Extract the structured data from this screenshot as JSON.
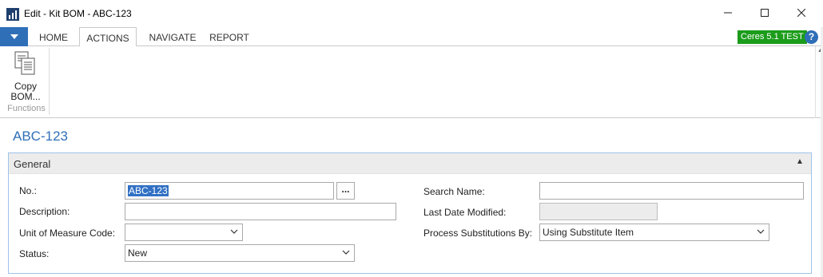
{
  "window": {
    "title": "Edit - Kit BOM - ABC-123",
    "minimize_glyph": "—",
    "maximize_glyph": "☐",
    "close_glyph": "✕"
  },
  "ribbon": {
    "tabs": [
      {
        "label": "HOME"
      },
      {
        "label": "ACTIONS"
      },
      {
        "label": "NAVIGATE"
      },
      {
        "label": "REPORT"
      }
    ],
    "active_tab": "ACTIONS",
    "environment_badge": "Ceres 5.1 TEST",
    "help_glyph": "?",
    "groups": [
      {
        "label": "Functions",
        "buttons": [
          {
            "label": "Copy\nBOM...",
            "icon": "copy-document-icon"
          }
        ]
      }
    ]
  },
  "page": {
    "title": "ABC-123",
    "fasttab": {
      "title": "General",
      "collapse_glyph": "▲"
    },
    "fields": {
      "no": {
        "label": "No.:",
        "value": "ABC-123",
        "lookup_glyph": "..."
      },
      "description": {
        "label": "Description:",
        "value": ""
      },
      "uom_code": {
        "label": "Unit of Measure Code:",
        "value": ""
      },
      "status": {
        "label": "Status:",
        "value": "New"
      },
      "search_name": {
        "label": "Search Name:",
        "value": ""
      },
      "last_date_modified": {
        "label": "Last Date Modified:",
        "value": ""
      },
      "process_substitutions_by": {
        "label": "Process Substitutions By:",
        "value": "Using Substitute Item"
      }
    }
  },
  "colors": {
    "accent": "#2f6fb7",
    "badge": "#1b9c1b",
    "selection": "#3170c4"
  }
}
